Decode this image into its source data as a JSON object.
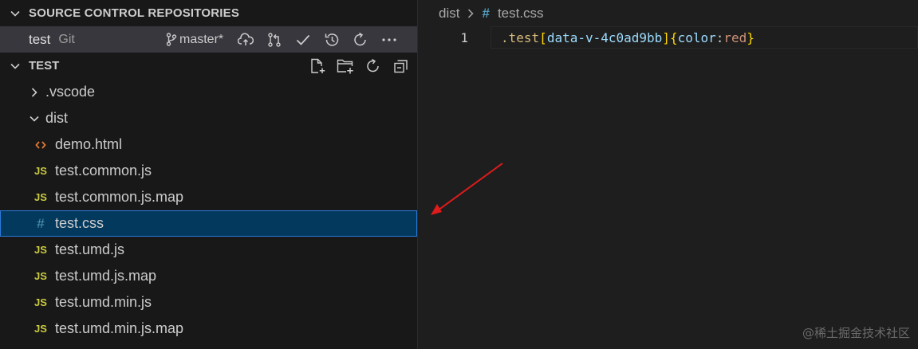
{
  "scm": {
    "header": "SOURCE CONTROL REPOSITORIES",
    "repo": {
      "name": "test",
      "type": "Git",
      "branch": "master*"
    },
    "actions": [
      "publish-branch-icon",
      "branch-compare-icon",
      "commit-check-icon",
      "history-icon",
      "refresh-icon",
      "more-icon"
    ]
  },
  "explorer": {
    "header": "TEST",
    "actions": [
      "new-file-icon",
      "new-folder-icon",
      "refresh-icon",
      "collapse-all-icon"
    ],
    "items": [
      {
        "label": ".vscode",
        "kind": "folder",
        "expanded": false
      },
      {
        "label": "dist",
        "kind": "folder",
        "expanded": true
      },
      {
        "label": "demo.html",
        "kind": "file",
        "icon": "<>"
      },
      {
        "label": "test.common.js",
        "kind": "file",
        "icon": "JS"
      },
      {
        "label": "test.common.js.map",
        "kind": "file",
        "icon": "JS"
      },
      {
        "label": "test.css",
        "kind": "file",
        "icon": "#",
        "selected": true
      },
      {
        "label": "test.umd.js",
        "kind": "file",
        "icon": "JS"
      },
      {
        "label": "test.umd.js.map",
        "kind": "file",
        "icon": "JS"
      },
      {
        "label": "test.umd.min.js",
        "kind": "file",
        "icon": "JS"
      },
      {
        "label": "test.umd.min.js.map",
        "kind": "file",
        "icon": "JS"
      }
    ]
  },
  "editor": {
    "breadcrumb": {
      "folder": "dist",
      "file_icon": "#",
      "file": "test.css"
    },
    "line_number": "1",
    "code": {
      "selector": ".test",
      "open_bracket": "[",
      "attr": "data-v-4c0ad9bb",
      "close_bracket": "]",
      "open_brace": "{",
      "property": "color",
      "colon": ":",
      "value": "red",
      "close_brace": "}"
    }
  },
  "watermark": "@稀土掘金技术社区",
  "colors": {
    "selection_bg": "#04395e",
    "selection_border": "#2b79d8",
    "arrow": "#e01b1b"
  }
}
